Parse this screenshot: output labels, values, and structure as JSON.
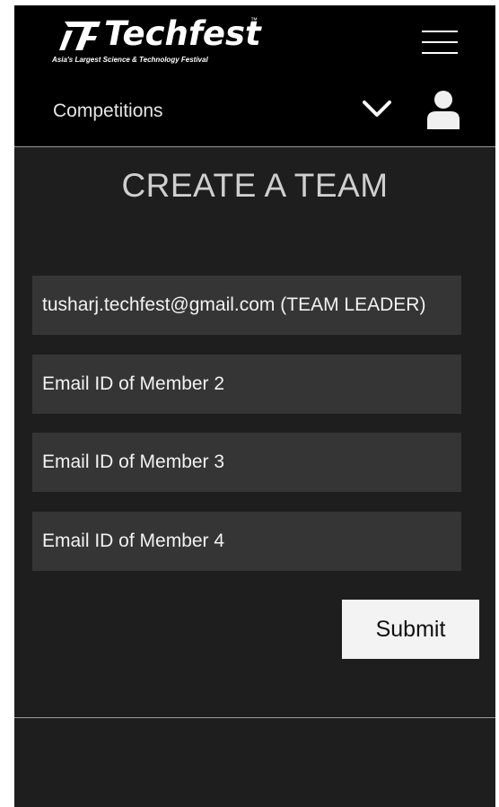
{
  "brand": {
    "name": "Techfest",
    "trademark": "™",
    "tagline": "Asia's Largest Science & Technology Festival"
  },
  "nav": {
    "current_section": "Competitions",
    "icons": {
      "menu": "hamburger-menu-icon",
      "dropdown": "chevron-down-icon",
      "account": "user-icon"
    }
  },
  "page": {
    "title": "CREATE A TEAM"
  },
  "form": {
    "leader": {
      "value": "tusharj.techfest@gmail.com (TEAM LEADER)"
    },
    "member2": {
      "placeholder": "Email ID of Member 2",
      "value": ""
    },
    "member3": {
      "placeholder": "Email ID of Member 3",
      "value": ""
    },
    "member4": {
      "placeholder": "Email ID of Member 4",
      "value": ""
    },
    "submit_label": "Submit"
  },
  "colors": {
    "header_bg": "#000000",
    "page_bg": "#1e1e1e",
    "field_bg": "#353535",
    "button_bg": "#f3f3f3",
    "divider": "#9a9a9a"
  }
}
